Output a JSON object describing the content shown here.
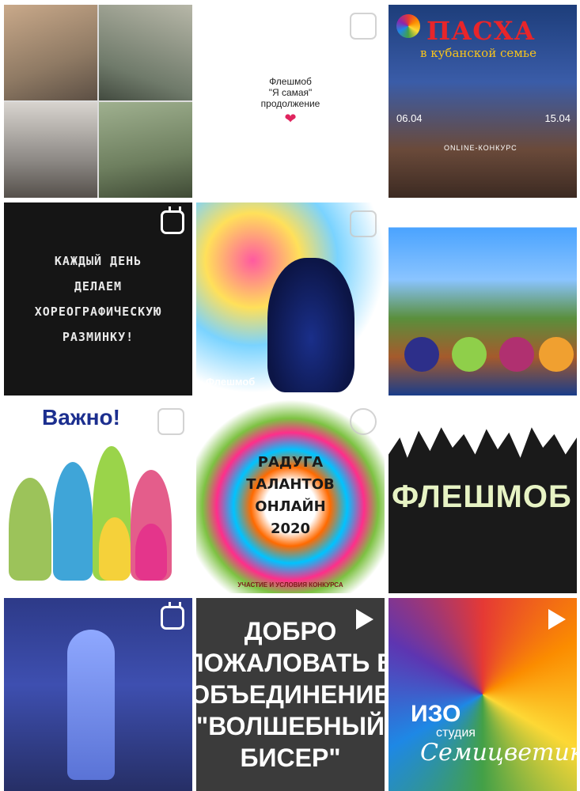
{
  "feed": {
    "tiles": [
      {
        "type": "photo-collage"
      },
      {
        "type": "text",
        "lines": [
          "Флешмоб",
          "\"Я самая\"",
          "продолжение"
        ],
        "emoji": "❤"
      },
      {
        "type": "poster",
        "title": "ПАСХА",
        "subtitle": "в кубанской семье",
        "date_start": "06.04",
        "date_end": "15.04",
        "note": "ONLINE-КОНКУРС"
      },
      {
        "type": "igtv",
        "lines": [
          "КАЖДЫЙ  ДЕНЬ",
          "ДЕЛАЕМ",
          "ХОРЕОГРАФИЧЕСКУЮ",
          "РАЗМИНКУ!"
        ]
      },
      {
        "type": "igtv",
        "caption": "Флешмоб"
      },
      {
        "type": "painting"
      },
      {
        "type": "poster",
        "title": "Важно!"
      },
      {
        "type": "poster",
        "lines": [
          "РАДУГА",
          "ТАЛАНТОВ",
          "ОНЛАЙН",
          "2020"
        ],
        "footer": "УЧАСТИЕ И УСЛОВИЯ КОНКУРСА"
      },
      {
        "type": "poster",
        "word": "ФЛЕШМОБ"
      },
      {
        "type": "igtv-video"
      },
      {
        "type": "video",
        "lines": [
          "ДОБРО",
          "ПОЖАЛОВАТЬ В",
          "ОБЪЕДИНЕНИЕ",
          "\"ВОЛШЕБНЫЙ",
          "БИСЕР\""
        ]
      },
      {
        "type": "video",
        "title": "ИЗО",
        "subtitle": "студия",
        "signature": "Семицветик"
      }
    ]
  },
  "colors": {
    "heart": "#e0245e",
    "easter_title": "#e8252a",
    "family_title": "#1c2f8f"
  }
}
